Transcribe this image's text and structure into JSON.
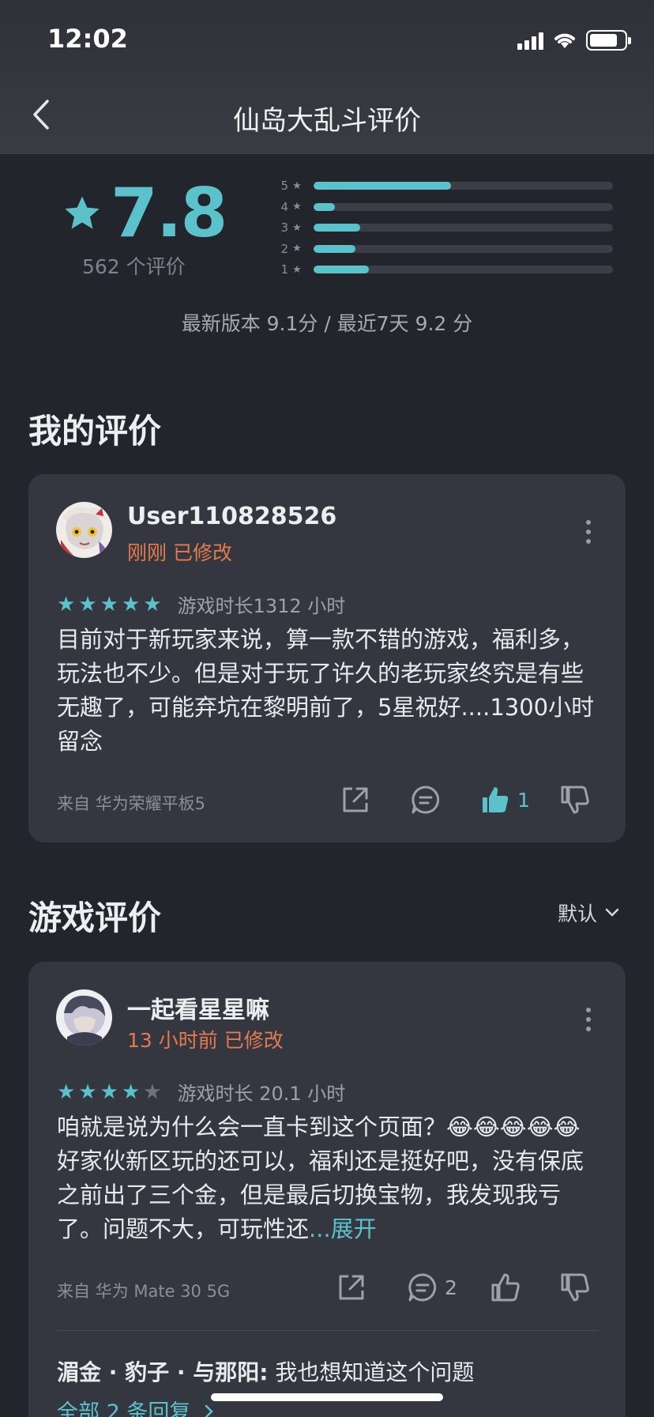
{
  "status_bar": {
    "time": "12:02"
  },
  "nav": {
    "title": "仙岛大乱斗评价"
  },
  "summary": {
    "score": "7.8",
    "count_text": "562 个评价",
    "distribution": [
      {
        "label": "5",
        "fraction": 0.46
      },
      {
        "label": "4",
        "fraction": 0.07
      },
      {
        "label": "3",
        "fraction": 0.155
      },
      {
        "label": "2",
        "fraction": 0.14
      },
      {
        "label": "1",
        "fraction": 0.185
      }
    ],
    "version_scores": "最新版本 9.1分 / 最近7天 9.2 分"
  },
  "my_review": {
    "section_title": "我的评价",
    "username": "User110828526",
    "time": "刚刚 已修改",
    "stars": 5,
    "playtime": "游戏时长1312 小时",
    "text": "目前对于新玩家来说，算一款不错的游戏，福利多，玩法也不少。但是对于玩了许久的老玩家终究是有些无趣了，可能弃坑在黎明前了，5星祝好....1300小时留念",
    "device": "来自 华为荣耀平板5",
    "like_count": "1"
  },
  "game_reviews": {
    "section_title": "游戏评价",
    "sort_label": "默认",
    "items": [
      {
        "username": "一起看星星嘛",
        "time": "13 小时前 已修改",
        "stars": 4,
        "playtime": "游戏时长 20.1 小时",
        "text_a": "咱就是说为什么会一直卡到这个页面？",
        "emoji": "😂",
        "text_b": "好家伙新区玩的还可以，福利还是挺好吧，没有保底之前出了三个金，但是最后切换宝物，我发现我亏了。问题不大，可玩性还",
        "expand_label": "...展开",
        "device": "来自 华为 Mate 30 5G",
        "comment_count": "2",
        "reply": {
          "user": "湄金 · 豹子 · 与那阳:",
          "text": " 我也想知道这个问题"
        },
        "all_replies": "全部 2 条回复"
      }
    ]
  },
  "colors": {
    "accent": "#5bc2cb",
    "time_orange": "#e47b4c",
    "background": "#23252d",
    "card": "#343740"
  }
}
